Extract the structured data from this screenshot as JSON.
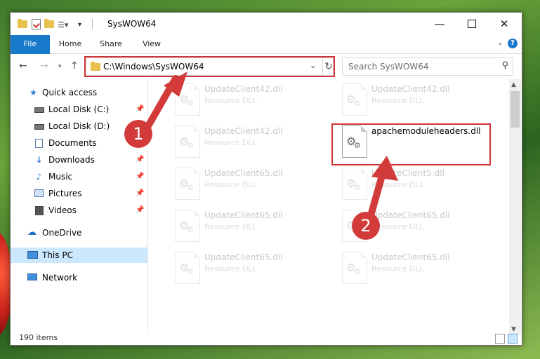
{
  "window": {
    "title": "SysWOW64"
  },
  "ribbon": {
    "tabs": [
      "File",
      "Home",
      "Share",
      "View"
    ],
    "help": "?"
  },
  "nav": {
    "address": "C:\\Windows\\SysWOW64",
    "search_placeholder": "Search SysWOW64"
  },
  "sidebar": {
    "items": [
      {
        "label": "Quick access",
        "icon": "star-icon"
      },
      {
        "label": "Local Disk (C:)",
        "icon": "drive-icon",
        "pinned": true
      },
      {
        "label": "Local Disk (D:)",
        "icon": "drive-icon",
        "pinned": false
      },
      {
        "label": "Documents",
        "icon": "documents-icon",
        "pinned": true
      },
      {
        "label": "Downloads",
        "icon": "download-icon",
        "pinned": true
      },
      {
        "label": "Music",
        "icon": "music-icon",
        "pinned": true
      },
      {
        "label": "Pictures",
        "icon": "pictures-icon",
        "pinned": true
      },
      {
        "label": "Videos",
        "icon": "videos-icon",
        "pinned": true
      },
      {
        "label": "OneDrive",
        "icon": "cloud-icon"
      },
      {
        "label": "This PC",
        "icon": "computer-icon",
        "selected": true
      },
      {
        "label": "Network",
        "icon": "network-icon"
      }
    ]
  },
  "files": [
    {
      "name": "UpdateClient42.dll",
      "type": "Resource DLL",
      "faded": true
    },
    {
      "name": "UpdateClient42.dll",
      "type": "Resource DLL",
      "faded": true
    },
    {
      "name": "UpdateClient42.dll",
      "type": "Resource DLL",
      "faded": true
    },
    {
      "name": "apachemoduleheaders.dll",
      "type": "",
      "faded": false
    },
    {
      "name": "UpdateClient65.dll",
      "type": "Resource DLL",
      "faded": true
    },
    {
      "name": "UpdateClient5.dll",
      "type": "Resource DLL",
      "faded": true
    },
    {
      "name": "UpdateClient65.dll",
      "type": "Resource DLL",
      "faded": true
    },
    {
      "name": "UpdateClient65.dll",
      "type": "Resource DLL",
      "faded": true
    },
    {
      "name": "UpdateClient65.dll",
      "type": "Resource DLL",
      "faded": true
    },
    {
      "name": "UpdateClient65.dll",
      "type": "Resource DLL",
      "faded": true
    }
  ],
  "status": {
    "item_count": "190 items"
  },
  "callouts": {
    "one": "1",
    "two": "2"
  },
  "colors": {
    "accent": "#1979ca",
    "highlight": "#d13438",
    "callout": "#d33b3b",
    "selection": "#cce8ff"
  }
}
